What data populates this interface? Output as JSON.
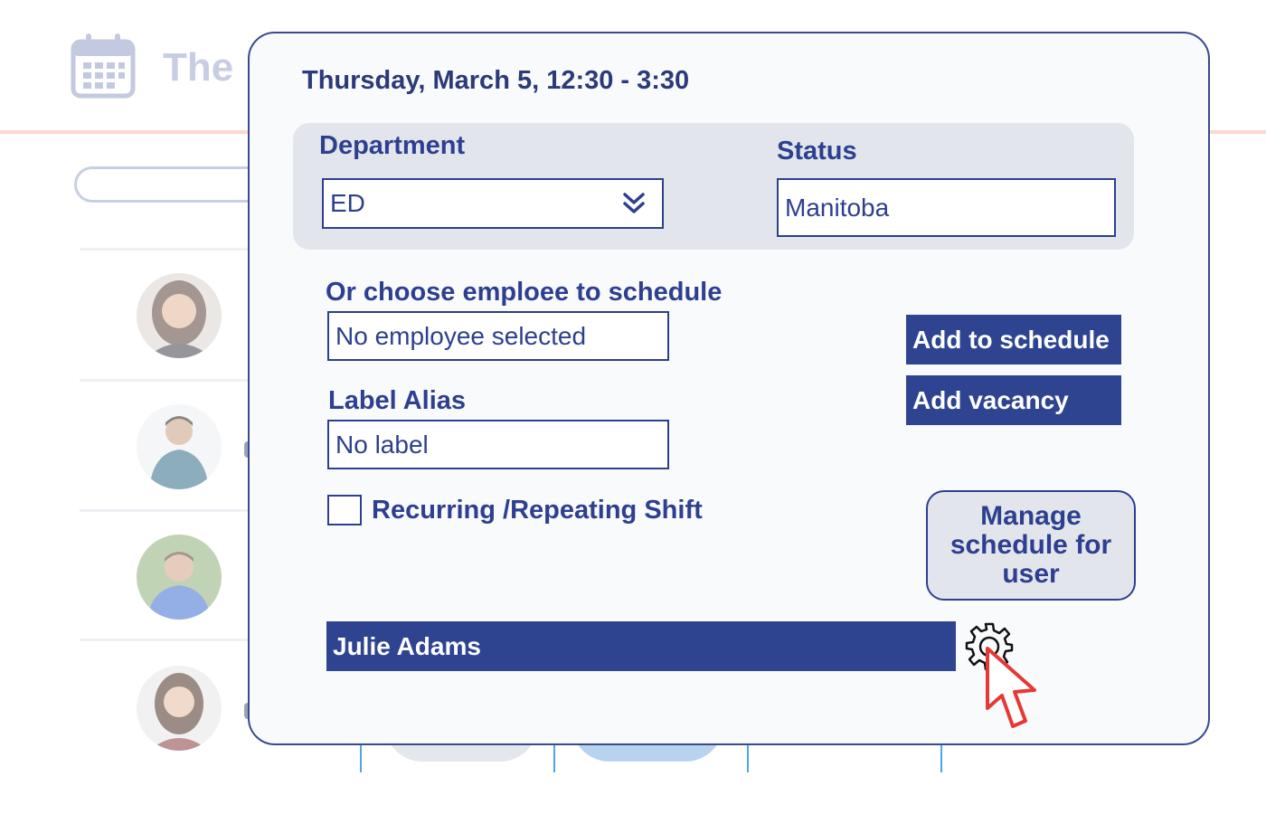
{
  "background": {
    "app_title": "The",
    "accent_rule_color": "#fbd9cf",
    "icons": [
      "calendar-icon"
    ]
  },
  "dialog": {
    "title": "Thursday, March 5, 12:30 - 3:30",
    "department": {
      "label": "Department",
      "value": "ED",
      "icon": "double-chevron-down-icon"
    },
    "status": {
      "label": "Status",
      "value": "Manitoba"
    },
    "employee": {
      "label": "Or choose emploee to schedule",
      "value": "No employee selected"
    },
    "label_alias": {
      "label": "Label Alias",
      "value": "No label"
    },
    "recurring": {
      "label": "Recurring /Repeating Shift",
      "checked": false
    },
    "buttons": {
      "add_to_schedule": "Add to schedule",
      "add_vacancy": "Add vacancy",
      "manage_schedule": "Manage schedule for user"
    },
    "selected_user": "Julie Adams",
    "settings_icon": "gear-icon",
    "pointer_icon": "cursor-arrow-icon"
  },
  "colors": {
    "primary": "#2f4490",
    "text": "#2d3f8f",
    "panel": "#e2e6ec",
    "cursor": "#e53935"
  }
}
